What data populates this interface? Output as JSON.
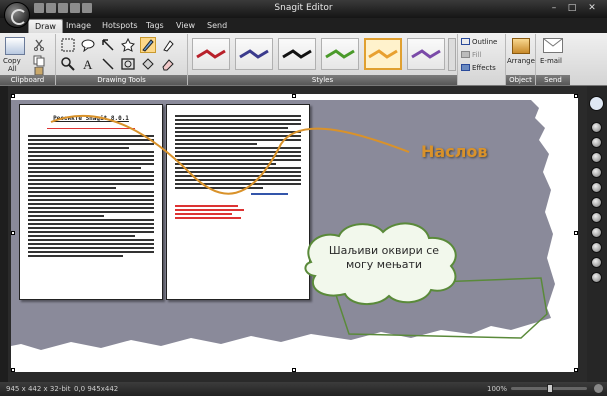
{
  "window": {
    "title": "Snagit Editor",
    "controls": [
      "–",
      "□",
      "✕"
    ]
  },
  "tabs": [
    {
      "label": "Draw",
      "active": true
    },
    {
      "label": "Image"
    },
    {
      "label": "Hotspots"
    },
    {
      "label": "Tags"
    },
    {
      "label": "View"
    },
    {
      "label": "Send"
    }
  ],
  "ribbon": {
    "clipboard": {
      "copy_label": "Copy",
      "copy_sub": "All",
      "group_label": "Clipboard"
    },
    "drawing_tools": {
      "group_label": "Drawing Tools"
    },
    "styles": {
      "group_label": "Styles",
      "thumb_colors": [
        "#b8202a",
        "#3a3a8c",
        "#111111",
        "#4a9a2a",
        "#e8a030",
        "#7a4aa8"
      ]
    },
    "effects": {
      "outline": "Outline",
      "fill": "Fill",
      "effects": "Effects"
    },
    "object": {
      "arrange": "Arrange",
      "group_label": "Object"
    },
    "send": {
      "email": "E-mail",
      "group_label": "Send"
    }
  },
  "canvas": {
    "callout_title": "Наслов",
    "cloud_text_line1": "Шаљиви оквири се",
    "cloud_text_line2": "могу мењати",
    "doc_heading": "Ресенкте Snagit 8.0.1",
    "accent_orange": "#d9922a",
    "accent_green": "#5a8a3a"
  },
  "status": {
    "size": "945 x 442 x 32-bit",
    "coords": "0,0  945x442",
    "zoom": "100%"
  }
}
